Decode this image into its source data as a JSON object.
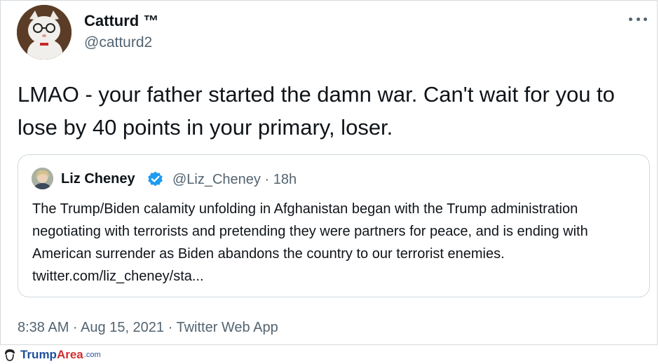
{
  "tweet": {
    "display_name": "Catturd ™",
    "handle": "@catturd2",
    "text": "LMAO - your father started the damn war. Can't wait for you to lose by 40 points in your primary, loser.",
    "timestamp": "8:38 AM · Aug 15, 2021 · Twitter Web App",
    "more_icon": "more-horizontal-icon"
  },
  "quote": {
    "display_name": "Liz Cheney",
    "handle_time": "@Liz_Cheney · 18h",
    "verified_icon": "verified-badge-icon",
    "text": "The Trump/Biden calamity unfolding in Afghanistan began with the Trump administration negotiating with terrorists and pretending they were partners for peace, and is ending with American surrender as Biden abandons the country to our terrorist enemies. twitter.com/liz_cheney/sta..."
  },
  "watermark": {
    "trump": "Trump",
    "area": "Area",
    "com": ".com"
  },
  "colors": {
    "text_primary": "#0f1419",
    "text_secondary": "#536471",
    "verified_blue": "#1d9bf0",
    "card_border": "#cfd9de"
  }
}
